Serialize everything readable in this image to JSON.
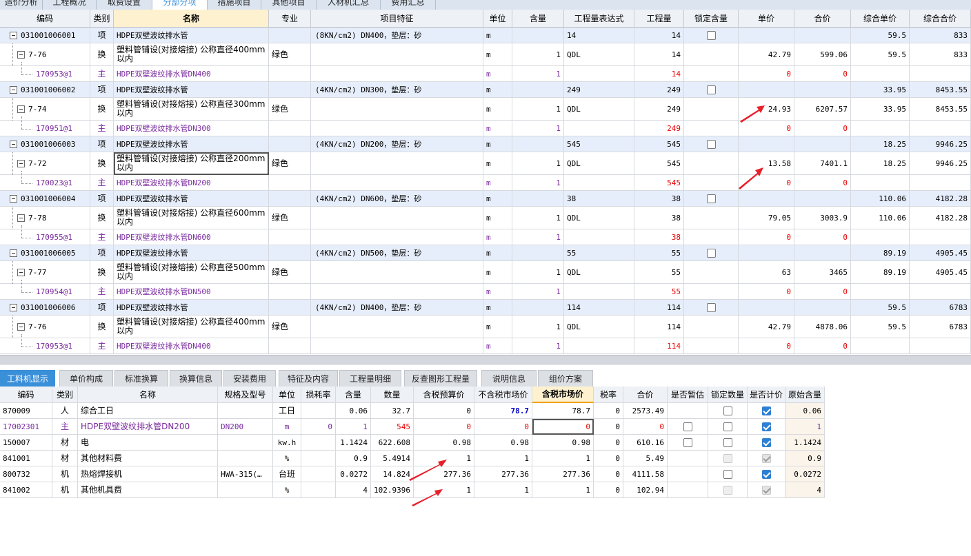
{
  "top_tabs": [
    {
      "label": "造价分析",
      "active": false
    },
    {
      "label": "工程概况",
      "active": false
    },
    {
      "label": "取费设置",
      "active": false
    },
    {
      "label": "分部分项",
      "active": true
    },
    {
      "label": "措施项目",
      "active": false
    },
    {
      "label": "其他项目",
      "active": false
    },
    {
      "label": "人材机汇总",
      "active": false
    },
    {
      "label": "费用汇总",
      "active": false
    }
  ],
  "upper_headers": [
    "编码",
    "类别",
    "名称",
    "专业",
    "项目特征",
    "单位",
    "含量",
    "工程量表达式",
    "工程量",
    "锁定含量",
    "单价",
    "合价",
    "综合单价",
    "综合合价"
  ],
  "upper_rows": [
    {
      "type": "item",
      "code": "031001006001",
      "cat": "项",
      "name": "HDPE双壁波纹排水管",
      "spec": "",
      "feature": "(8KN/cm2) DN400，垫层：砂",
      "unit": "m",
      "qty_ratio": "",
      "expr": "14",
      "qty": "14",
      "lock": false,
      "price": "",
      "total": "",
      "uprice": "59.5",
      "utotal": "833"
    },
    {
      "type": "sub",
      "code": "7-76",
      "cat": "换",
      "name": "塑料管铺设(对接熔接) 公称直径400mm以内",
      "spec": "绿色",
      "feature": "",
      "unit": "m",
      "qty_ratio": "1",
      "expr": "QDL",
      "qty": "14",
      "price": "42.79",
      "total": "599.06",
      "uprice": "59.5",
      "utotal": "833"
    },
    {
      "type": "main",
      "code": "170953@1",
      "cat": "主",
      "name": "HDPE双壁波纹排水管DN400",
      "spec": "",
      "feature": "",
      "unit": "m",
      "qty_ratio": "1",
      "expr": "",
      "qty": "14",
      "price": "0",
      "total": "0",
      "uprice": "",
      "utotal": ""
    },
    {
      "type": "item",
      "code": "031001006002",
      "cat": "项",
      "name": "HDPE双壁波纹排水管",
      "spec": "",
      "feature": "(4KN/cm2) DN300，垫层：砂",
      "unit": "m",
      "qty_ratio": "",
      "expr": "249",
      "qty": "249",
      "lock": false,
      "price": "",
      "total": "",
      "uprice": "33.95",
      "utotal": "8453.55"
    },
    {
      "type": "sub",
      "code": "7-74",
      "cat": "换",
      "name": "塑料管铺设(对接熔接) 公称直径300mm以内",
      "spec": "绿色",
      "feature": "",
      "unit": "m",
      "qty_ratio": "1",
      "expr": "QDL",
      "qty": "249",
      "price": "24.93",
      "total": "6207.57",
      "uprice": "33.95",
      "utotal": "8453.55"
    },
    {
      "type": "main",
      "code": "170951@1",
      "cat": "主",
      "name": "HDPE双壁波纹排水管DN300",
      "spec": "",
      "feature": "",
      "unit": "m",
      "qty_ratio": "1",
      "expr": "",
      "qty": "249",
      "price": "0",
      "total": "0",
      "uprice": "",
      "utotal": ""
    },
    {
      "type": "item",
      "code": "031001006003",
      "cat": "项",
      "name": "HDPE双壁波纹排水管",
      "spec": "",
      "feature": "(4KN/cm2) DN200，垫层：砂",
      "unit": "m",
      "qty_ratio": "",
      "expr": "545",
      "qty": "545",
      "lock": false,
      "price": "",
      "total": "",
      "uprice": "18.25",
      "utotal": "9946.25"
    },
    {
      "type": "sub",
      "code": "7-72",
      "cat": "换",
      "name": "塑料管铺设(对接熔接) 公称直径200mm以内",
      "spec": "绿色",
      "feature": "",
      "unit": "m",
      "qty_ratio": "1",
      "expr": "QDL",
      "qty": "545",
      "price": "13.58",
      "total": "7401.1",
      "uprice": "18.25",
      "utotal": "9946.25",
      "selected": true
    },
    {
      "type": "main",
      "code": "170023@1",
      "cat": "主",
      "name": "HDPE双壁波纹排水管DN200",
      "spec": "",
      "feature": "",
      "unit": "m",
      "qty_ratio": "1",
      "expr": "",
      "qty": "545",
      "price": "0",
      "total": "0",
      "uprice": "",
      "utotal": ""
    },
    {
      "type": "item",
      "code": "031001006004",
      "cat": "项",
      "name": "HDPE双壁波纹排水管",
      "spec": "",
      "feature": "(4KN/cm2) DN600，垫层：砂",
      "unit": "m",
      "qty_ratio": "",
      "expr": "38",
      "qty": "38",
      "lock": false,
      "price": "",
      "total": "",
      "uprice": "110.06",
      "utotal": "4182.28"
    },
    {
      "type": "sub",
      "code": "7-78",
      "cat": "换",
      "name": "塑料管铺设(对接熔接) 公称直径600mm以内",
      "spec": "绿色",
      "feature": "",
      "unit": "m",
      "qty_ratio": "1",
      "expr": "QDL",
      "qty": "38",
      "price": "79.05",
      "total": "3003.9",
      "uprice": "110.06",
      "utotal": "4182.28"
    },
    {
      "type": "main",
      "code": "170955@1",
      "cat": "主",
      "name": "HDPE双壁波纹排水管DN600",
      "spec": "",
      "feature": "",
      "unit": "m",
      "qty_ratio": "1",
      "expr": "",
      "qty": "38",
      "price": "0",
      "total": "0",
      "uprice": "",
      "utotal": ""
    },
    {
      "type": "item",
      "code": "031001006005",
      "cat": "项",
      "name": "HDPE双壁波纹排水管",
      "spec": "",
      "feature": "(4KN/cm2) DN500，垫层：砂",
      "unit": "m",
      "qty_ratio": "",
      "expr": "55",
      "qty": "55",
      "lock": false,
      "price": "",
      "total": "",
      "uprice": "89.19",
      "utotal": "4905.45"
    },
    {
      "type": "sub",
      "code": "7-77",
      "cat": "换",
      "name": "塑料管铺设(对接熔接) 公称直径500mm以内",
      "spec": "绿色",
      "feature": "",
      "unit": "m",
      "qty_ratio": "1",
      "expr": "QDL",
      "qty": "55",
      "price": "63",
      "total": "3465",
      "uprice": "89.19",
      "utotal": "4905.45"
    },
    {
      "type": "main",
      "code": "170954@1",
      "cat": "主",
      "name": "HDPE双壁波纹排水管DN500",
      "spec": "",
      "feature": "",
      "unit": "m",
      "qty_ratio": "1",
      "expr": "",
      "qty": "55",
      "price": "0",
      "total": "0",
      "uprice": "",
      "utotal": ""
    },
    {
      "type": "item",
      "code": "031001006006",
      "cat": "项",
      "name": "HDPE双壁波纹排水管",
      "spec": "",
      "feature": "(4KN/cm2) DN400，垫层：砂",
      "unit": "m",
      "qty_ratio": "",
      "expr": "114",
      "qty": "114",
      "lock": false,
      "price": "",
      "total": "",
      "uprice": "59.5",
      "utotal": "6783"
    },
    {
      "type": "sub",
      "code": "7-76",
      "cat": "换",
      "name": "塑料管铺设(对接熔接) 公称直径400mm以内",
      "spec": "绿色",
      "feature": "",
      "unit": "m",
      "qty_ratio": "1",
      "expr": "QDL",
      "qty": "114",
      "price": "42.79",
      "total": "4878.06",
      "uprice": "59.5",
      "utotal": "6783"
    },
    {
      "type": "main",
      "code": "170953@1",
      "cat": "主",
      "name": "HDPE双壁波纹排水管DN400",
      "spec": "",
      "feature": "",
      "unit": "m",
      "qty_ratio": "1",
      "expr": "",
      "qty": "114",
      "price": "0",
      "total": "0",
      "uprice": "",
      "utotal": ""
    }
  ],
  "bottom_tabs": [
    {
      "label": "工料机显示",
      "active": true
    },
    {
      "label": "单价构成",
      "active": false
    },
    {
      "label": "标准换算",
      "active": false
    },
    {
      "label": "换算信息",
      "active": false
    },
    {
      "label": "安装费用",
      "active": false
    },
    {
      "label": "特征及内容",
      "active": false
    },
    {
      "label": "工程量明细",
      "active": false
    },
    {
      "label": "反查图形工程量",
      "active": false
    },
    {
      "label": "说明信息",
      "active": false
    },
    {
      "label": "组价方案",
      "active": false
    }
  ],
  "lower_headers": [
    "编码",
    "类别",
    "名称",
    "规格及型号",
    "单位",
    "损耗率",
    "含量",
    "数量",
    "含税预算价",
    "不含税市场价",
    "含税市场价",
    "税率",
    "合价",
    "是否暂估",
    "锁定数量",
    "是否计价",
    "原始含量"
  ],
  "lower_rows": [
    {
      "code": "870009",
      "cat": "人",
      "name": "综合工日",
      "model": "",
      "unit": "工日",
      "loss": "",
      "ratio": "0.06",
      "qty": "32.7",
      "tax_budget": "0",
      "notax_market": "78.7",
      "tax_market": "78.7",
      "rate": "0",
      "total": "2573.49",
      "est": "none",
      "lockq": "off",
      "priced": "on",
      "orig": "0.06",
      "style": "normal"
    },
    {
      "code": "17002301",
      "cat": "主",
      "name": "HDPE双壁波纹排水管DN200",
      "model": "DN200",
      "unit": "m",
      "loss": "0",
      "ratio": "1",
      "qty": "545",
      "tax_budget": "0",
      "notax_market": "0",
      "tax_market": "0",
      "rate": "0",
      "total": "0",
      "est": "off",
      "lockq": "off",
      "priced": "on",
      "orig": "1",
      "style": "main"
    },
    {
      "code": "150007",
      "cat": "材",
      "name": "电",
      "model": "",
      "unit": "kw.h",
      "loss": "",
      "ratio": "1.1424",
      "qty": "622.608",
      "tax_budget": "0.98",
      "notax_market": "0.98",
      "tax_market": "0.98",
      "rate": "0",
      "total": "610.16",
      "est": "off",
      "lockq": "off",
      "priced": "on",
      "orig": "1.1424",
      "style": "normal"
    },
    {
      "code": "841001",
      "cat": "材",
      "name": "其他材料费",
      "model": "",
      "unit": "%",
      "loss": "",
      "ratio": "0.9",
      "qty": "5.4914",
      "tax_budget": "1",
      "notax_market": "1",
      "tax_market": "1",
      "rate": "0",
      "total": "5.49",
      "est": "none",
      "lockq": "dis",
      "priced": "dison",
      "orig": "0.9",
      "style": "normal"
    },
    {
      "code": "800732",
      "cat": "机",
      "name": "热熔焊接机",
      "model": "HWA-315(…",
      "unit": "台班",
      "loss": "",
      "ratio": "0.0272",
      "qty": "14.824",
      "tax_budget": "277.36",
      "notax_market": "277.36",
      "tax_market": "277.36",
      "rate": "0",
      "total": "4111.58",
      "est": "none",
      "lockq": "off",
      "priced": "on",
      "orig": "0.0272",
      "style": "normal"
    },
    {
      "code": "841002",
      "cat": "机",
      "name": "其他机具费",
      "model": "",
      "unit": "%",
      "loss": "",
      "ratio": "4",
      "qty": "102.9396",
      "tax_budget": "1",
      "notax_market": "1",
      "tax_market": "1",
      "rate": "0",
      "total": "102.94",
      "est": "none",
      "lockq": "dis",
      "priced": "dison",
      "orig": "4",
      "style": "normal"
    }
  ],
  "colors": {
    "accent": "#3a8fd9",
    "item_row": "#e7eefb",
    "main_text": "#7a2a9e",
    "main_qty": "#e60000",
    "annotation_arrow": "#e8202a"
  }
}
